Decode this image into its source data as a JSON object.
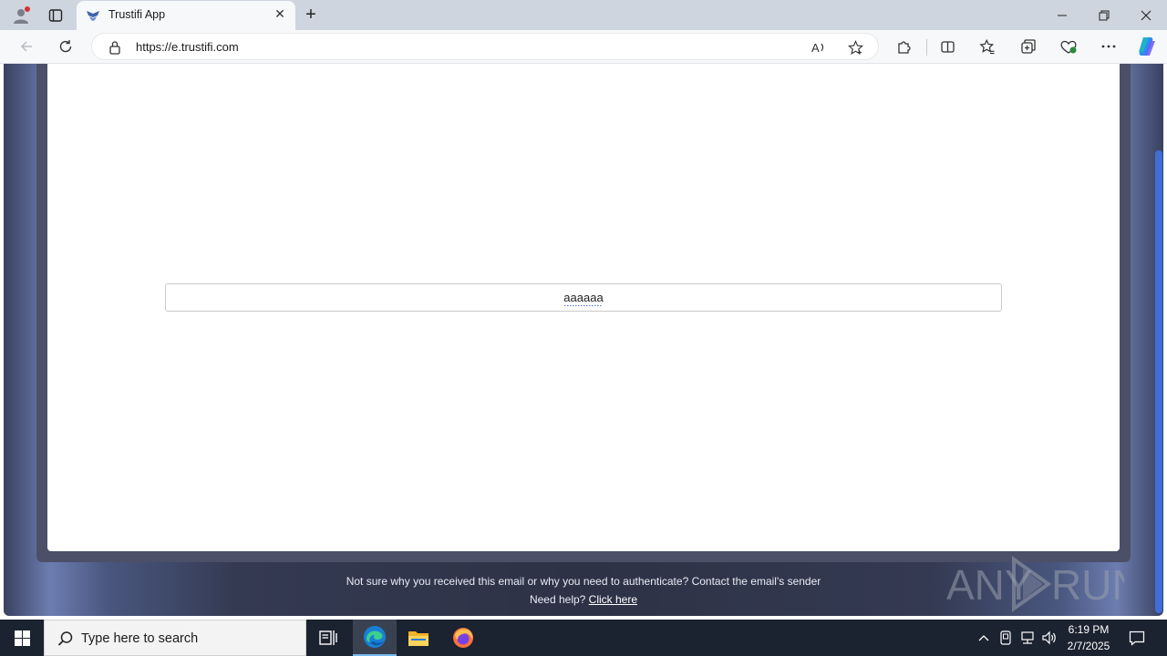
{
  "browser": {
    "tab_title": "Trustifi App",
    "url": "https://e.trustifi.com",
    "new_tab_symbol": "+",
    "close_tab_symbol": "✕"
  },
  "page": {
    "code_input_value": "aaaaaa",
    "footer_line1": "Not sure why you received this email or why you need to authenticate? Contact the email's sender",
    "footer_line2_prefix": "Need help? ",
    "footer_help_link": "Click here",
    "watermark_text": "ANY RUN"
  },
  "taskbar": {
    "search_placeholder": "Type here to search",
    "time": "6:19 PM",
    "date": "2/7/2025"
  },
  "colors": {
    "accent_blue": "#3f6fd6",
    "page_background": "#2d3246",
    "card": "#ffffff"
  },
  "icons": [
    "profile-icon",
    "tab-actions-icon",
    "trustifi-favicon",
    "close-icon",
    "new-tab-icon",
    "minimize-icon",
    "restore-icon",
    "window-close-icon",
    "back-icon",
    "refresh-icon",
    "lock-icon",
    "read-aloud-icon",
    "favorite-star-icon",
    "extensions-icon",
    "split-screen-icon",
    "favorites-icon",
    "collections-icon",
    "performance-icon",
    "more-icon",
    "copilot-icon",
    "windows-start-icon",
    "search-icon",
    "task-view-icon",
    "edge-icon",
    "file-explorer-icon",
    "firefox-icon",
    "chevron-up-icon",
    "network-icon",
    "volume-icon",
    "notification-icon"
  ]
}
